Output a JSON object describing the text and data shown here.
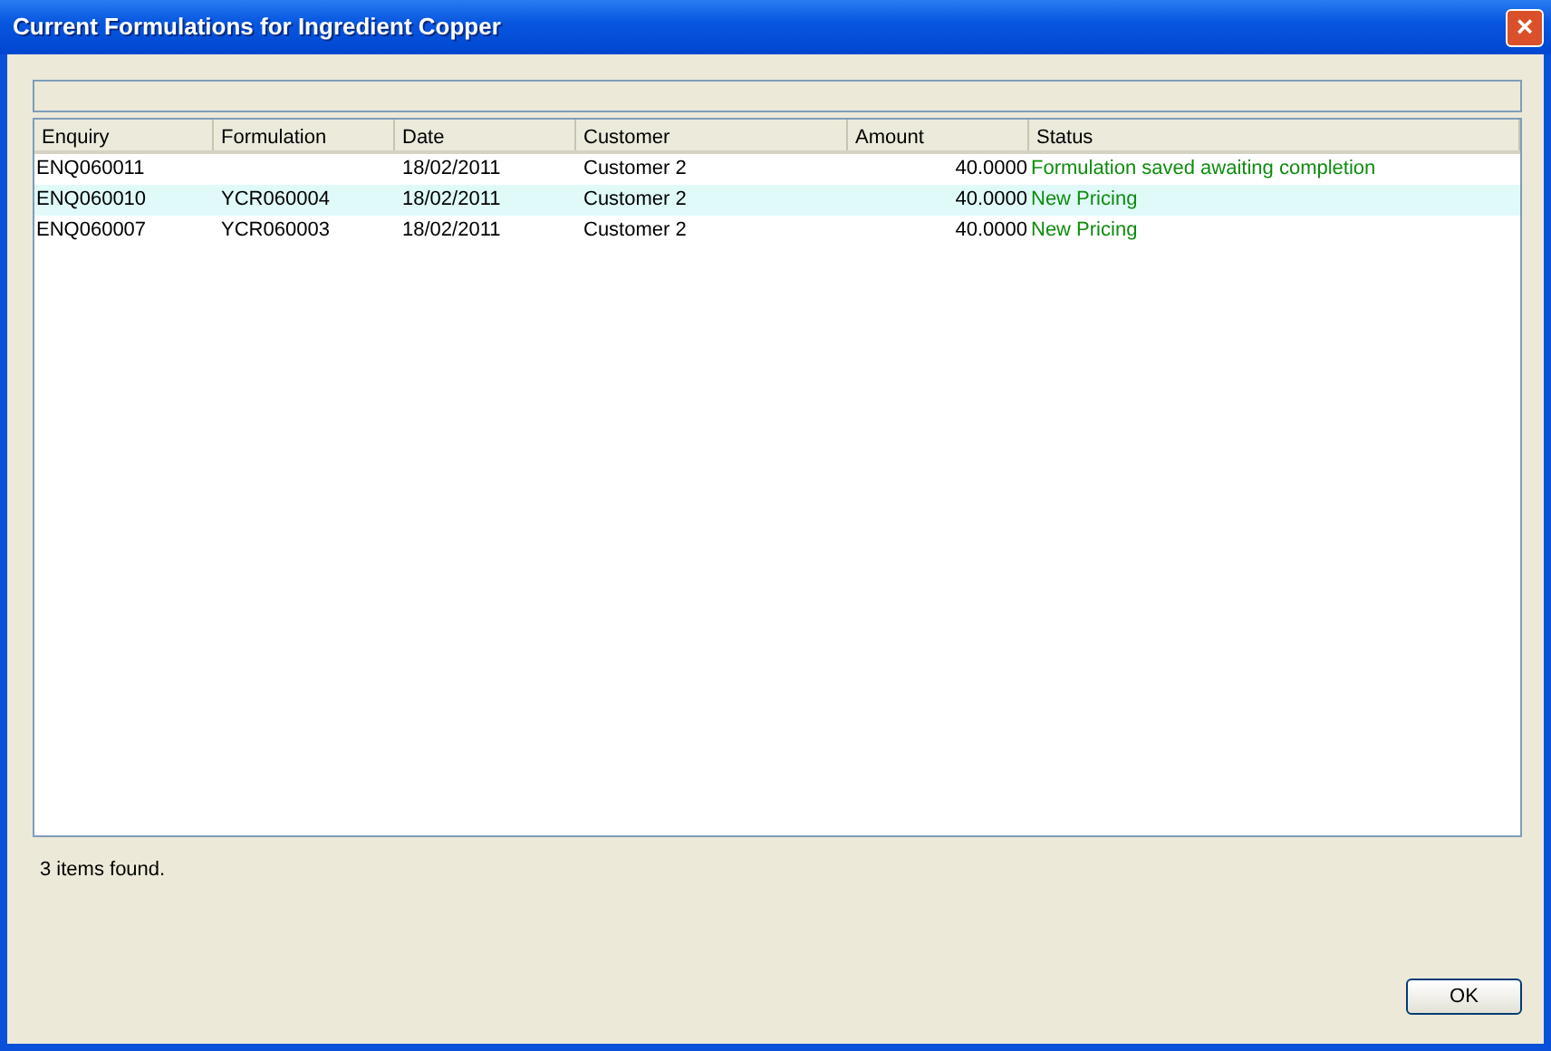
{
  "window": {
    "title": "Current Formulations for Ingredient Copper",
    "close": "×"
  },
  "table": {
    "columns": [
      "Enquiry",
      "Formulation",
      "Date",
      "Customer",
      "Amount",
      "Status"
    ],
    "rows": [
      {
        "cells": [
          "ENQ060011",
          "",
          "18/02/2011",
          "Customer 2",
          "40.0000",
          "Formulation saved awaiting completion"
        ],
        "highlighted": false
      },
      {
        "cells": [
          "ENQ060010",
          "YCR060004",
          "18/02/2011",
          "Customer 2",
          "40.0000",
          "New Pricing"
        ],
        "highlighted": true
      },
      {
        "cells": [
          "ENQ060007",
          "YCR060003",
          "18/02/2011",
          "Customer 2",
          "40.0000",
          "New Pricing"
        ],
        "highlighted": false
      }
    ]
  },
  "status_text": "3 items found.",
  "buttons": [
    "OK"
  ]
}
